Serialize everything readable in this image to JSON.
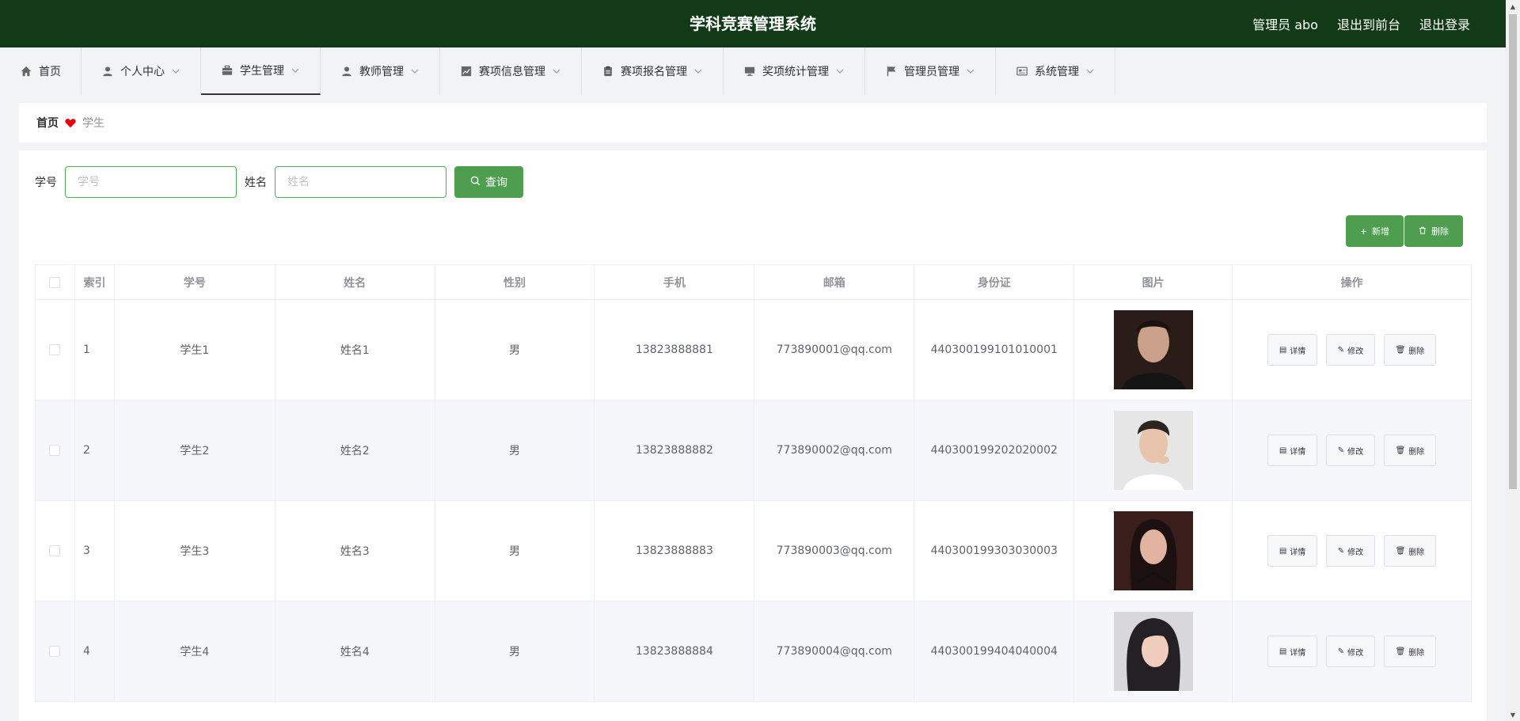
{
  "header": {
    "title": "学科竞赛管理系统",
    "user": "管理员 abo",
    "frontend_link": "退出到前台",
    "logout_link": "退出登录"
  },
  "nav": [
    {
      "label": "首页",
      "icon": "home-icon"
    },
    {
      "label": "个人中心",
      "icon": "user-icon"
    },
    {
      "label": "学生管理",
      "icon": "briefcase-icon"
    },
    {
      "label": "教师管理",
      "icon": "user-icon"
    },
    {
      "label": "赛项信息管理",
      "icon": "chart-icon"
    },
    {
      "label": "赛项报名管理",
      "icon": "clipboard-icon"
    },
    {
      "label": "奖项统计管理",
      "icon": "monitor-icon"
    },
    {
      "label": "管理员管理",
      "icon": "flag-icon"
    },
    {
      "label": "系统管理",
      "icon": "card-icon"
    }
  ],
  "breadcrumb": {
    "home": "首页",
    "current": "学生"
  },
  "search": {
    "student_id_label": "学号",
    "student_id_placeholder": "学号",
    "name_label": "姓名",
    "name_placeholder": "姓名",
    "query_button": "查询"
  },
  "actions": {
    "add": "新增",
    "delete": "删除"
  },
  "table": {
    "headers": [
      "索引",
      "学号",
      "姓名",
      "性别",
      "手机",
      "邮箱",
      "身份证",
      "图片",
      "操作"
    ],
    "rows": [
      {
        "index": "1",
        "student_id": "学生1",
        "name": "姓名1",
        "gender": "男",
        "phone": "13823888881",
        "email": "773890001@qq.com",
        "id_card": "440300199101010001"
      },
      {
        "index": "2",
        "student_id": "学生2",
        "name": "姓名2",
        "gender": "男",
        "phone": "13823888882",
        "email": "773890002@qq.com",
        "id_card": "440300199202020002"
      },
      {
        "index": "3",
        "student_id": "学生3",
        "name": "姓名3",
        "gender": "男",
        "phone": "13823888883",
        "email": "773890003@qq.com",
        "id_card": "440300199303030003"
      },
      {
        "index": "4",
        "student_id": "学生4",
        "name": "姓名4",
        "gender": "男",
        "phone": "13823888884",
        "email": "773890004@qq.com",
        "id_card": "440300199404040004"
      }
    ],
    "row_actions": {
      "detail": "详情",
      "edit": "修改",
      "delete": "删除"
    }
  },
  "colors": {
    "header_bg": "#123a17",
    "accent": "#4f9e4f",
    "heart": "#e60012"
  }
}
